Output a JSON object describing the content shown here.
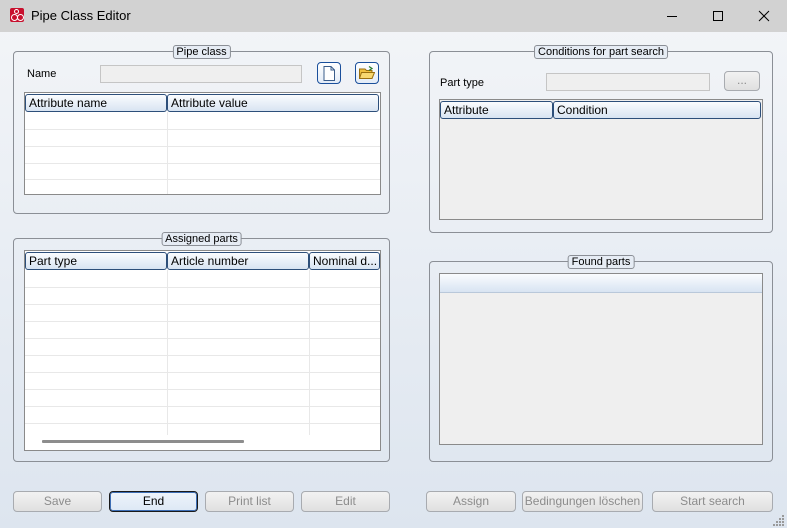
{
  "window": {
    "title": "Pipe Class Editor"
  },
  "pipe_class": {
    "group_title": "Pipe class",
    "name_label": "Name",
    "name_value": "",
    "columns": [
      "Attribute name",
      "Attribute value"
    ]
  },
  "assigned_parts": {
    "group_title": "Assigned parts",
    "columns": [
      "Part type",
      "Article number",
      "Nominal d..."
    ]
  },
  "conditions": {
    "group_title": "Conditions for part search",
    "part_type_label": "Part type",
    "part_type_value": "",
    "browse_label": "...",
    "columns": [
      "Attribute",
      "Condition"
    ]
  },
  "found_parts": {
    "group_title": "Found parts"
  },
  "buttons": {
    "save": "Save",
    "end": "End",
    "print_list": "Print list",
    "edit": "Edit",
    "assign": "Assign",
    "bedingungen_loeschen": "Bedingungen löschen",
    "start_search": "Start search"
  },
  "colors": {
    "titlebar": "#d2d2d2",
    "app_icon": "#c8102e",
    "focus_border": "#3d6eb5",
    "disabled_text": "#8c8c8c"
  }
}
